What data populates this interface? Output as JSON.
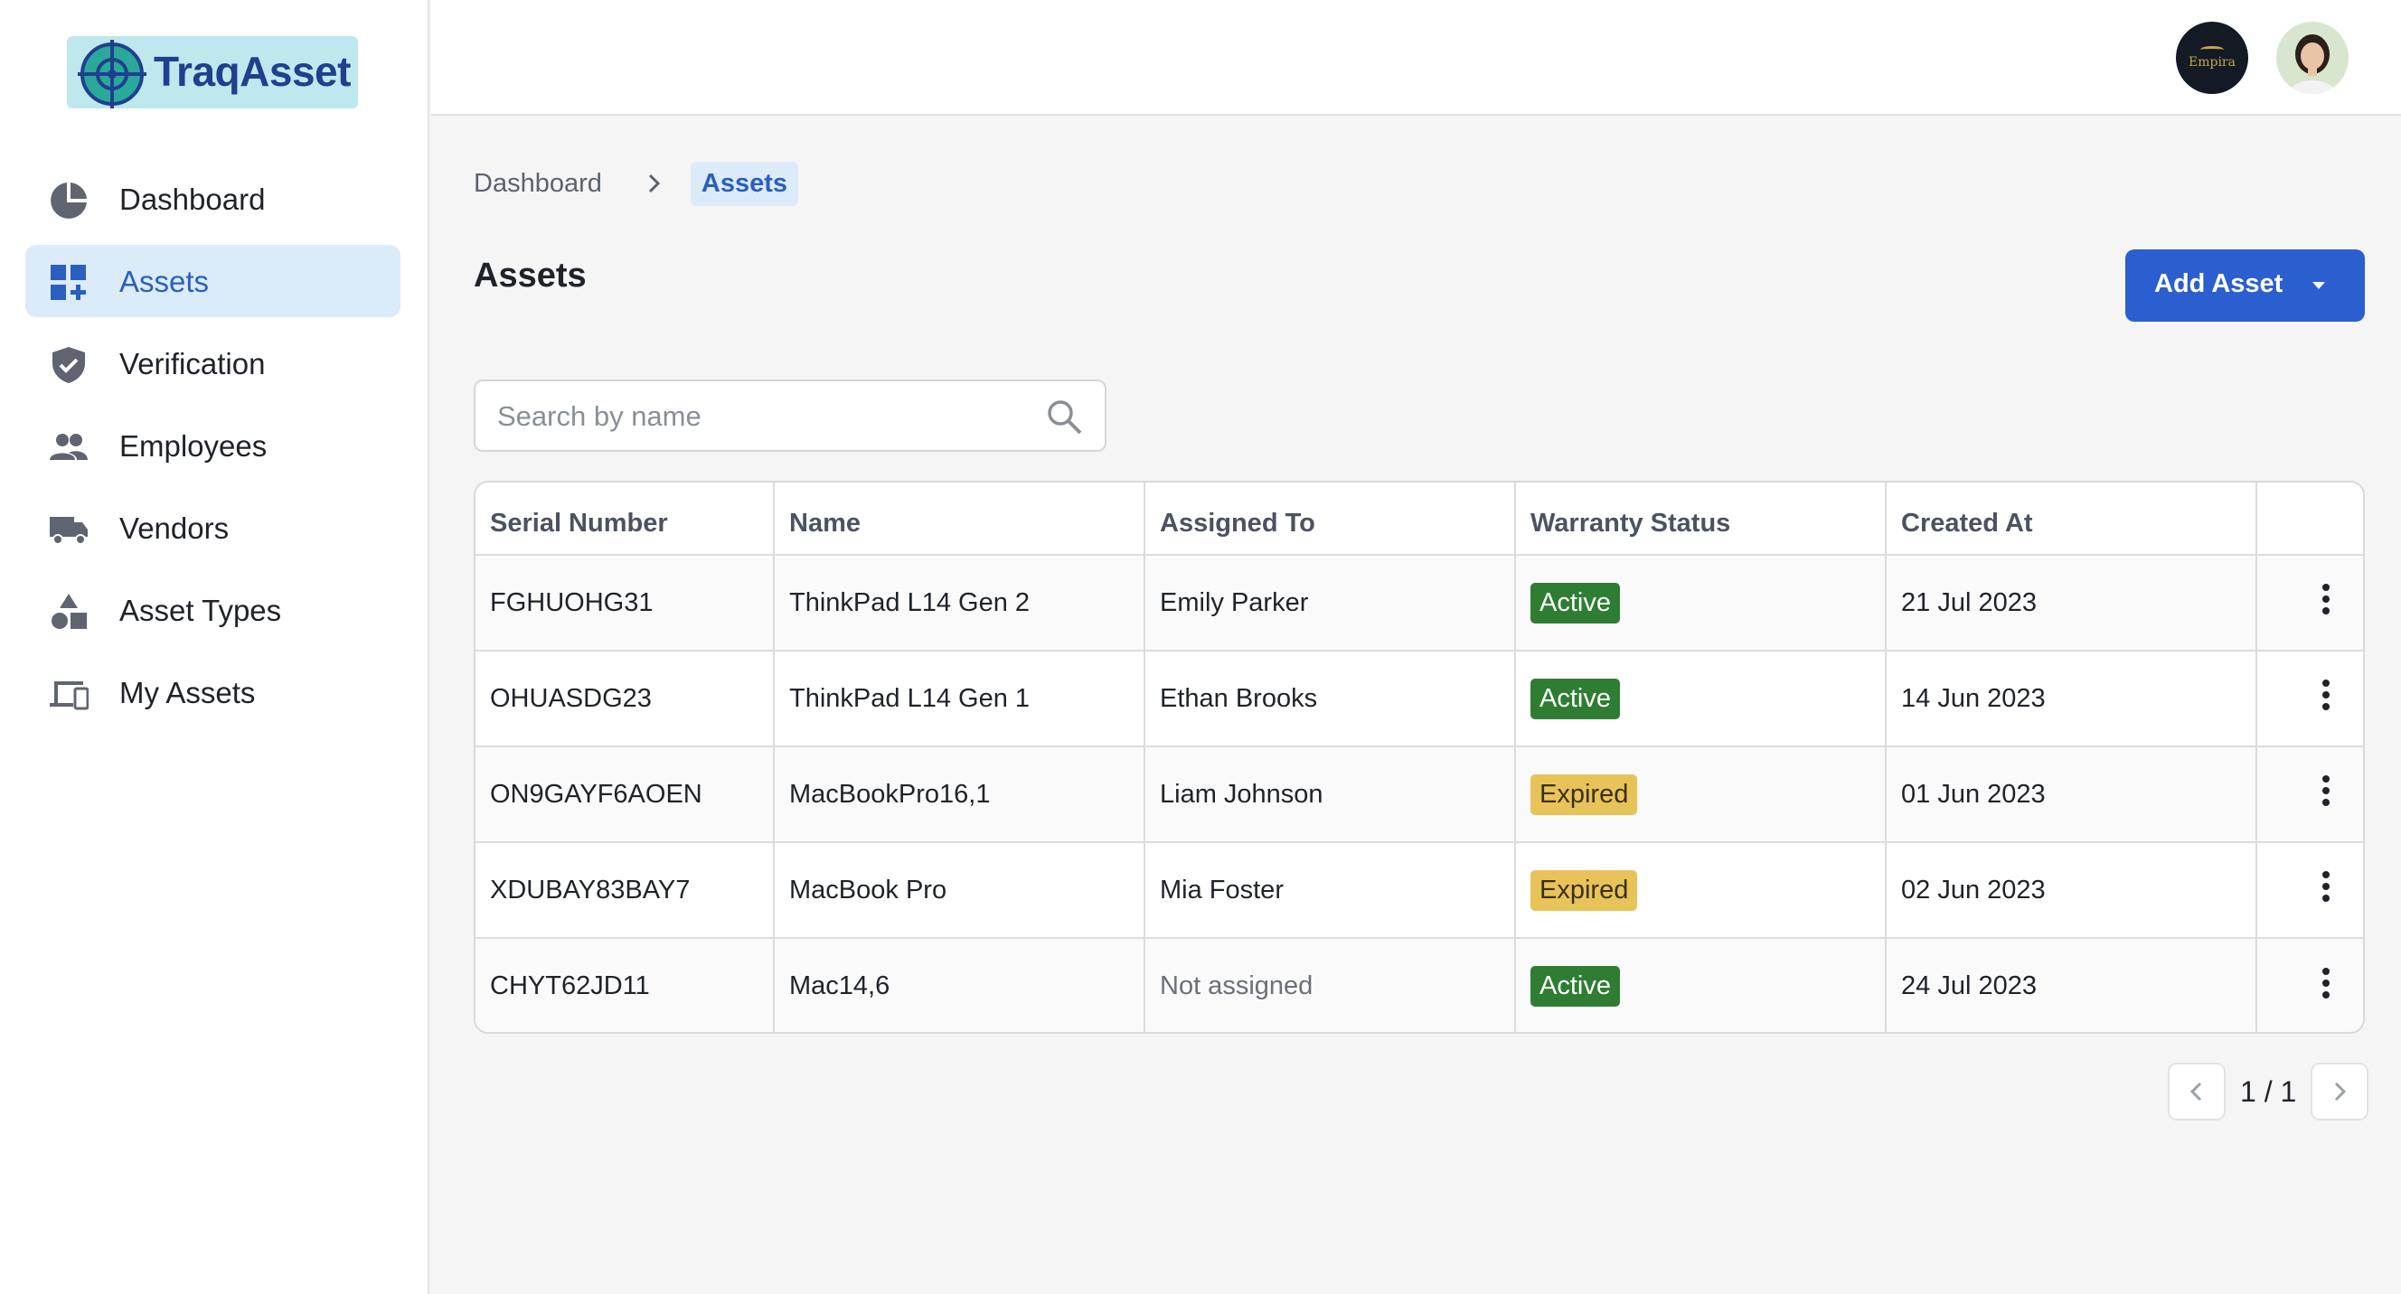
{
  "app": {
    "logo_text": "TraqAsset"
  },
  "sidebar": {
    "items": [
      {
        "label": "Dashboard",
        "icon": "pie-chart-icon",
        "active": false
      },
      {
        "label": "Assets",
        "icon": "dashboard-add-icon",
        "active": true
      },
      {
        "label": "Verification",
        "icon": "shield-check-icon",
        "active": false
      },
      {
        "label": "Employees",
        "icon": "people-icon",
        "active": false
      },
      {
        "label": "Vendors",
        "icon": "truck-icon",
        "active": false
      },
      {
        "label": "Asset Types",
        "icon": "shapes-icon",
        "active": false
      },
      {
        "label": "My Assets",
        "icon": "devices-icon",
        "active": false
      }
    ]
  },
  "topbar": {
    "org_name": "Empira"
  },
  "breadcrumb": {
    "items": [
      "Dashboard",
      "Assets"
    ]
  },
  "page": {
    "title": "Assets",
    "add_button": "Add Asset",
    "search_placeholder": "Search by name"
  },
  "table": {
    "columns": [
      "Serial Number",
      "Name",
      "Assigned To",
      "Warranty Status",
      "Created At",
      ""
    ],
    "rows": [
      {
        "serial": "FGHUOHG31",
        "name": "ThinkPad L14 Gen 2",
        "assigned": "Emily Parker",
        "warranty": "Active",
        "created": "21 Jul 2023"
      },
      {
        "serial": "OHUASDG23",
        "name": "ThinkPad L14 Gen 1",
        "assigned": "Ethan Brooks",
        "warranty": "Active",
        "created": "14 Jun 2023"
      },
      {
        "serial": "ON9GAYF6AOEN",
        "name": "MacBookPro16,1",
        "assigned": "Liam Johnson",
        "warranty": "Expired",
        "created": "01 Jun 2023"
      },
      {
        "serial": "XDUBAY83BAY7",
        "name": "MacBook Pro",
        "assigned": "Mia Foster",
        "warranty": "Expired",
        "created": "02 Jun 2023"
      },
      {
        "serial": "CHYT62JD11",
        "name": "Mac14,6",
        "assigned": "Not assigned",
        "warranty": "Active",
        "created": "24 Jul 2023"
      }
    ]
  },
  "pagination": {
    "text": "1 / 1"
  },
  "colors": {
    "primary": "#2b5fd0",
    "active_badge": "#2e7d32",
    "expired_badge": "#e8c35a",
    "nav_active_bg": "#dcebfa"
  }
}
